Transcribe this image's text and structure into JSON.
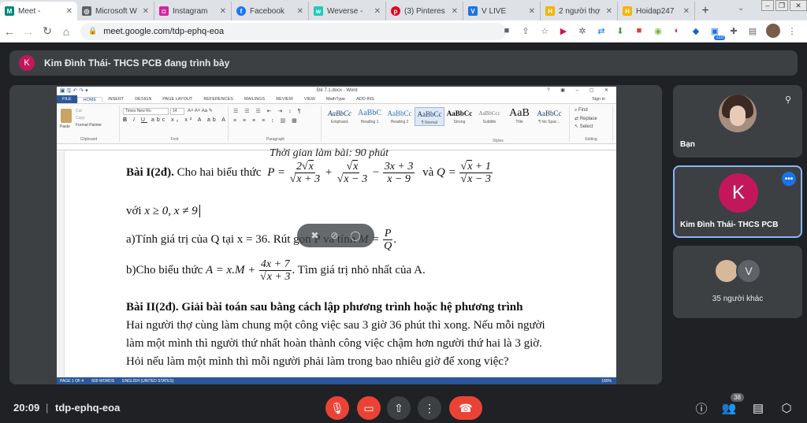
{
  "browser": {
    "tabs": [
      {
        "label": "Meet -",
        "icon": "meet-icon",
        "color": "#00897b",
        "active": true
      },
      {
        "label": "Microsoft W",
        "icon": "globe-icon",
        "color": "#5f6368"
      },
      {
        "label": "Instagram",
        "icon": "instagram-icon",
        "color": "#d6249f"
      },
      {
        "label": "Facebook",
        "icon": "facebook-icon",
        "color": "#1877f2"
      },
      {
        "label": "Weverse -",
        "icon": "weverse-icon",
        "color": "#1ecab8"
      },
      {
        "label": "(3) Pinteres",
        "icon": "pinterest-icon",
        "color": "#e60023"
      },
      {
        "label": "V LIVE",
        "icon": "vlive-icon",
        "color": "#1a73e8"
      },
      {
        "label": "2 người thợ",
        "icon": "hoidap-icon",
        "color": "#f4b400"
      },
      {
        "label": "Hoidap247",
        "icon": "hoidap-icon",
        "color": "#f4b400"
      }
    ],
    "url": "meet.google.com/tdp-ephq-eoa",
    "ext_badge": "110"
  },
  "banner": {
    "avatar_letter": "K",
    "text": "Kim Đình Thái- THCS PCB đang trình bày"
  },
  "word": {
    "title": "Đề 7.1.docx - Word",
    "tabs": [
      "FILE",
      "HOME",
      "INSERT",
      "DESIGN",
      "PAGE LAYOUT",
      "REFERENCES",
      "MAILINGS",
      "REVIEW",
      "VIEW",
      "MathType",
      "ADD-INS"
    ],
    "sign_in": "Sign in",
    "font_name": "Times New Ro",
    "font_size": "14",
    "group_labels": [
      "Clipboard",
      "Font",
      "Paragraph",
      "Styles",
      "Editing"
    ],
    "clipboard": [
      "Paste",
      "Cut",
      "Copy",
      "Format Painter"
    ],
    "editing": [
      "Find",
      "Replace",
      "Select"
    ],
    "styles": [
      {
        "preview": "AaBbCc",
        "name": "Emphasis"
      },
      {
        "preview": "AaBbC",
        "name": "Heading 1"
      },
      {
        "preview": "AaBbCc",
        "name": "Heading 2"
      },
      {
        "preview": "AaBbCc",
        "name": "¶ Normal"
      },
      {
        "preview": "AaBbCc",
        "name": "Strong"
      },
      {
        "preview": "AaBbCcc",
        "name": "Subtitle"
      },
      {
        "preview": "AaB",
        "name": "Title"
      },
      {
        "preview": "AaBbCc",
        "name": "¶ No Spac..."
      }
    ],
    "status": {
      "page": "PAGE 1 OF 4",
      "words": "600 WORDS",
      "lang": "ENGLISH (UNITED STATES)",
      "zoom": "160%"
    },
    "doc": {
      "heading_partial": "Thời gian làm bài: 90 phút",
      "bai1_label": "Bài I(2đ).",
      "bai1_text": "Cho hai biểu thức",
      "with_cond": "với",
      "part_a": "a)Tính giá trị của Q tại x = 36. Rút gọn P và tính",
      "part_b_pre": "b)Cho biểu thức",
      "part_b_post": ". Tìm giá trị nhỏ nhất của A.",
      "bai2": "Bài II(2đ). Giải bài toán sau bằng cách lập phương trình hoặc hệ phương trình",
      "p1": "Hai người thợ cùng làm chung một công việc sau 3 giờ 36 phút thì xong. Nếu mỗi người",
      "p2": "làm một mình thì người thứ nhất hoàn thành công việc chậm hơn người thứ hai là 3 giờ.",
      "p3": "Hỏi nếu làm một mình thì mỗi người phải làm trong bao nhiêu giờ để xong việc?"
    }
  },
  "tiles": {
    "you": "Bạn",
    "presenter_letter": "K",
    "presenter": "Kim Đình Thái- THCS PCB",
    "others_letter": "V",
    "others": "35 người khác"
  },
  "bottom": {
    "time": "20:09",
    "code": "tdp-ephq-eoa",
    "people_count": "38"
  }
}
